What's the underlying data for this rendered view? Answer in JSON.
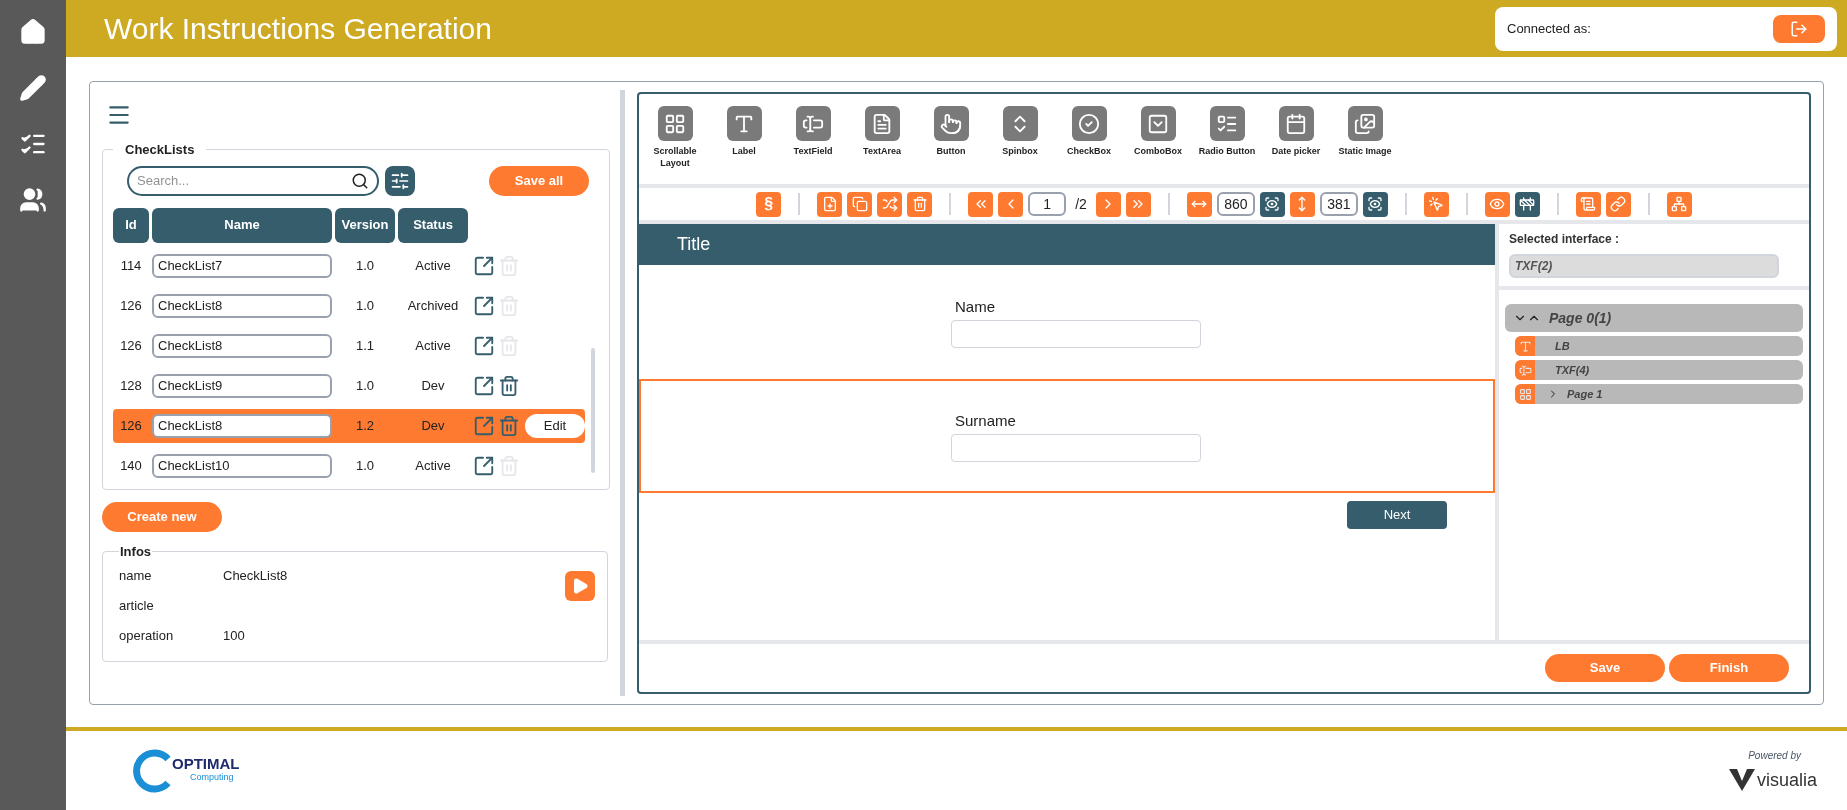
{
  "header": {
    "title": "Work Instructions Generation",
    "connected_label": "Connected as:"
  },
  "sidebar": {
    "items": [
      {
        "selected": false
      },
      {
        "selected": false
      },
      {
        "selected": false
      },
      {
        "selected": false
      }
    ]
  },
  "checklists": {
    "legend": "CheckLists",
    "search": {
      "placeholder": "Search..."
    },
    "save_all": "Save all",
    "columns": [
      "Id",
      "Name",
      "Version",
      "Status"
    ],
    "rows": [
      {
        "id": "114",
        "name": "CheckList7",
        "version": "1.0",
        "status": "Active",
        "deletable": false,
        "selected": false
      },
      {
        "id": "126",
        "name": "CheckList8",
        "version": "1.0",
        "status": "Archived",
        "deletable": false,
        "selected": false
      },
      {
        "id": "126",
        "name": "CheckList8",
        "version": "1.1",
        "status": "Active",
        "deletable": false,
        "selected": false
      },
      {
        "id": "128",
        "name": "CheckList9",
        "version": "1.0",
        "status": "Dev",
        "deletable": true,
        "selected": false
      },
      {
        "id": "126",
        "name": "CheckList8",
        "version": "1.2",
        "status": "Dev",
        "deletable": true,
        "selected": true,
        "action": "Edit"
      },
      {
        "id": "140",
        "name": "CheckList10",
        "version": "1.0",
        "status": "Active",
        "deletable": false,
        "selected": false
      }
    ],
    "create_new": "Create new"
  },
  "infos": {
    "legend": "Infos",
    "fields": [
      {
        "label": "name",
        "value": "CheckList8"
      },
      {
        "label": "article"
      },
      {
        "label": "operation",
        "value": "100"
      }
    ]
  },
  "palette": [
    "Scrollable Layout",
    "Label",
    "TextField",
    "TextArea",
    "Button",
    "Spinbox",
    "CheckBox",
    "ComboBox",
    "Radio Button",
    "Date picker",
    "Static Image"
  ],
  "toolbar": [
    {
      "kind": "accent",
      "text": "§"
    },
    {
      "kind": "separator"
    },
    {
      "kind": "accent"
    },
    {
      "kind": "accent"
    },
    {
      "kind": "accent"
    },
    {
      "kind": "accent"
    },
    {
      "kind": "separator"
    },
    {
      "kind": "accent"
    },
    {
      "kind": "accent"
    },
    {
      "kind": "input",
      "value": "1"
    },
    {
      "kind": "label",
      "text": "/2"
    },
    {
      "kind": "accent"
    },
    {
      "kind": "accent"
    },
    {
      "kind": "separator"
    },
    {
      "kind": "accent"
    },
    {
      "kind": "input",
      "value": "860"
    },
    {
      "kind": "dark"
    },
    {
      "kind": "accent"
    },
    {
      "kind": "input",
      "value": "381"
    },
    {
      "kind": "dark"
    },
    {
      "kind": "separator"
    },
    {
      "kind": "accent"
    },
    {
      "kind": "separator"
    },
    {
      "kind": "accent"
    },
    {
      "kind": "dark"
    },
    {
      "kind": "separator"
    },
    {
      "kind": "accent"
    },
    {
      "kind": "accent"
    },
    {
      "kind": "separator"
    },
    {
      "kind": "accent"
    }
  ],
  "canvas": {
    "title": "Title",
    "sections": [
      {
        "label": "Name",
        "selected": false
      },
      {
        "label": "Surname",
        "selected": true
      }
    ],
    "next": "Next"
  },
  "inspector": {
    "selected_label": "Selected interface :",
    "selected_value": "TXF(2)",
    "tree": [
      {
        "label": "Page 0(1)",
        "expanded": true,
        "children": [
          {
            "label": "LB",
            "kind": "label"
          },
          {
            "label": "TXF(4)",
            "kind": "textfield"
          },
          {
            "label": "Page 1",
            "kind": "layout",
            "expanded": false
          }
        ]
      }
    ]
  },
  "actions": [
    "Save",
    "Finish"
  ],
  "footer": {
    "logo_name": "OPTIMAL",
    "logo_sub": "Computing",
    "powered": "Powered by",
    "brand": "visualia"
  }
}
